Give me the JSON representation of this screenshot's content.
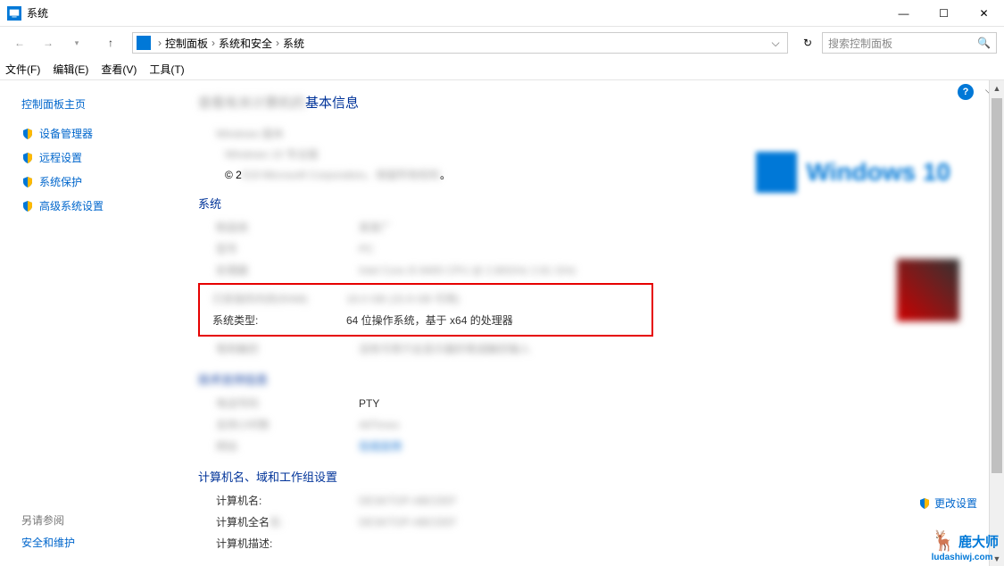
{
  "window": {
    "title": "系统",
    "minimize": "—",
    "maximize": "☐",
    "close": "✕"
  },
  "nav": {
    "breadcrumb": {
      "root": "控制面板",
      "mid": "系统和安全",
      "leaf": "系统"
    },
    "search_placeholder": "搜索控制面板"
  },
  "menu": {
    "file": "文件(F)",
    "edit": "编辑(E)",
    "view": "查看(V)",
    "tools": "工具(T)"
  },
  "sidebar": {
    "home": "控制面板主页",
    "links": [
      "设备管理器",
      "远程设置",
      "系统保护",
      "高级系统设置"
    ],
    "see_also_title": "另请参阅",
    "see_also_link": "安全和维护"
  },
  "page": {
    "title_suffix": "基本信息",
    "copyright_prefix": "© 2",
    "sections": {
      "system": "系统",
      "computer": "计算机名、域和工作组设置"
    },
    "rows": {
      "system_type_label": "系统类型:",
      "system_type_value": "64 位操作系统，基于 x64 的处理器",
      "pty_value": "PTY",
      "computer_name_label": "计算机名:",
      "computer_full_label": "计算机全名",
      "computer_desc_label": "计算机描述:"
    },
    "change_settings": "更改设置"
  },
  "watermark": {
    "name": "鹿大师",
    "url": "ludashiwj.com"
  }
}
